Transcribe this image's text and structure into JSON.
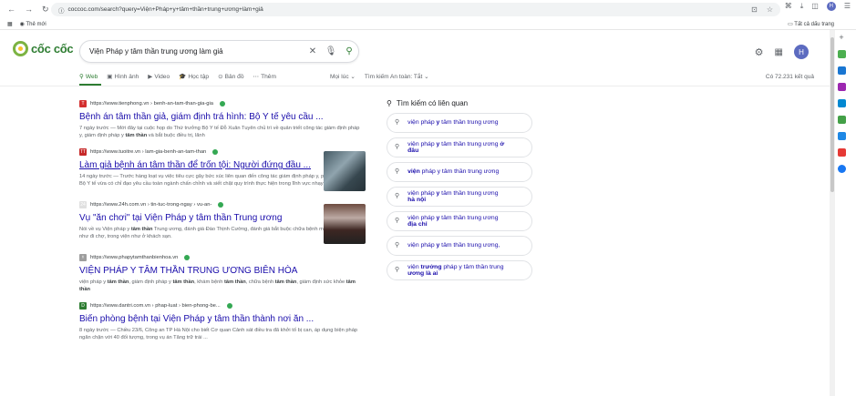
{
  "browser": {
    "url": "coccoc.com/search?query=Viện+Pháp+y+tâm+thần+trung+ương+làm+giả",
    "bookmark_new": "Thẻ mới",
    "bookmarks_all": "Tất cả dấu trang"
  },
  "logo": "cốc cốc",
  "search": {
    "query": "Viện Pháp y tâm thần trung ương làm giả"
  },
  "tabs": [
    {
      "label": "Web",
      "icon": "search-icon"
    },
    {
      "label": "Hình ảnh",
      "icon": "image-icon"
    },
    {
      "label": "Video",
      "icon": "video-icon"
    },
    {
      "label": "Học tập",
      "icon": "graduation-icon"
    },
    {
      "label": "Bản đồ",
      "icon": "map-pin-icon"
    },
    {
      "label": "Thêm",
      "icon": "more-icon"
    }
  ],
  "tools": {
    "time": "Mọi lúc",
    "safe": "Tìm kiếm An toàn: Tắt"
  },
  "result_count": "Có 72.231 kết quả",
  "avatar": "H",
  "results": [
    {
      "source": "https://www.tienphong.vn › benh-an-tam-than-gia-gia",
      "title": "Bệnh án tâm thần giả, giám định trá hình: Bộ Y tế yêu cầu ...",
      "snippet": "7 ngày trước — Mới đây tại cuộc họp do Thứ trưởng Bộ Y tế Đỗ Xuân Tuyên chủ trì về quản triết công tác giám định pháp y, giám định pháp y tâm thần và bắt buộc điều trị, lãnh",
      "fav_color": "#d32f2f",
      "fav": "T"
    },
    {
      "source": "https://www.tuoitre.vn › lam-gia-benh-an-tam-than",
      "title": "Làm giả bệnh án tâm thần để trốn tội: Người đứng đầu ...",
      "snippet": "14 ngày trước — Trước hàng loạt vụ việc tiêu cực gây bức xúc liên quan đến công tác giám định pháp y, pháp y tâm thần. Bộ Y tế vừa có chỉ đạo yêu cầu toàn ngành chấn chỉnh và siết chặt quy trình thực hiện trong lĩnh vực nhạy cảm này",
      "fav_color": "#c62828",
      "fav": "TT"
    },
    {
      "source": "https://www.24h.com.vn › tin-tuc-trong-ngay › vu-an-",
      "title": "Vụ \"ăn chơi\" tại Viện Pháp y tâm thần Trung ương",
      "snippet": "Nói về vụ Viện pháp y tâm thần Trung ương, đánh giá Đào Thịnh Cường, đánh giá bắt buộc chữa bệnh mà ra vào viện như đi chợ, trong viện như ở khách sạn.",
      "fav_color": "#e0e0e0",
      "fav": "24"
    },
    {
      "source": "https://www.phapytamthanbienhoa.vn",
      "title": "VIỆN PHÁP Y TÂM THẦN TRUNG ƯƠNG BIÊN HÒA",
      "snippet": "viện pháp y tâm thần, giám định pháp y tâm thần, khám bệnh tâm thần, chữa bệnh tâm thần, giám định sức khỏe tâm thần",
      "fav_color": "#9e9e9e",
      "fav": "⚕"
    },
    {
      "source": "https://www.dantri.com.vn › phap-luat › bien-phong-be...",
      "title": "Biến phòng bệnh tại Viện Pháp y tâm thần thành nơi ăn ...",
      "snippet": "8 ngày trước — Chiều 23/6, Công an TP Hà Nội cho biết Cơ quan Cảnh sát điều tra đã khởi tố bị can, áp dụng biện pháp ngăn chặn với 40 đối tượng, trong vụ án Tăng trữ trái ...",
      "fav_color": "#2e7d32",
      "fav": "D"
    }
  ],
  "related": {
    "title": "Tìm kiếm có liên quan",
    "items": [
      {
        "pre": "viện pháp ",
        "bold": "y",
        "post": " tâm thần trung ương",
        "line2": ""
      },
      {
        "pre": "viện pháp ",
        "bold": "y",
        "post": " tâm thần trung ương ",
        "bold2": "ở",
        "line2": "đâu"
      },
      {
        "pre": "",
        "bold": "viện",
        "post": " pháp y tâm thần trung ương",
        "line2": ""
      },
      {
        "pre": "viện pháp ",
        "bold": "y",
        "post": " tâm thần trung ương",
        "line2": "hà nội"
      },
      {
        "pre": "viện pháp ",
        "bold": "y",
        "post": " tâm thần trung ương",
        "line2": "địa chỉ"
      },
      {
        "pre": "viện pháp ",
        "bold": "y",
        "post": " tâm thần trung ương,",
        "line2": ""
      },
      {
        "pre": "viện ",
        "bold": "trưởng",
        "post": " pháp y tâm thần trung",
        "line2": "ương là ai"
      }
    ]
  },
  "sidebar_colors": [
    "#4caf50",
    "#1976d2",
    "#9c27b0",
    "#0288d1",
    "#43a047",
    "#1e88e5",
    "#e53935",
    "#1877f2"
  ]
}
